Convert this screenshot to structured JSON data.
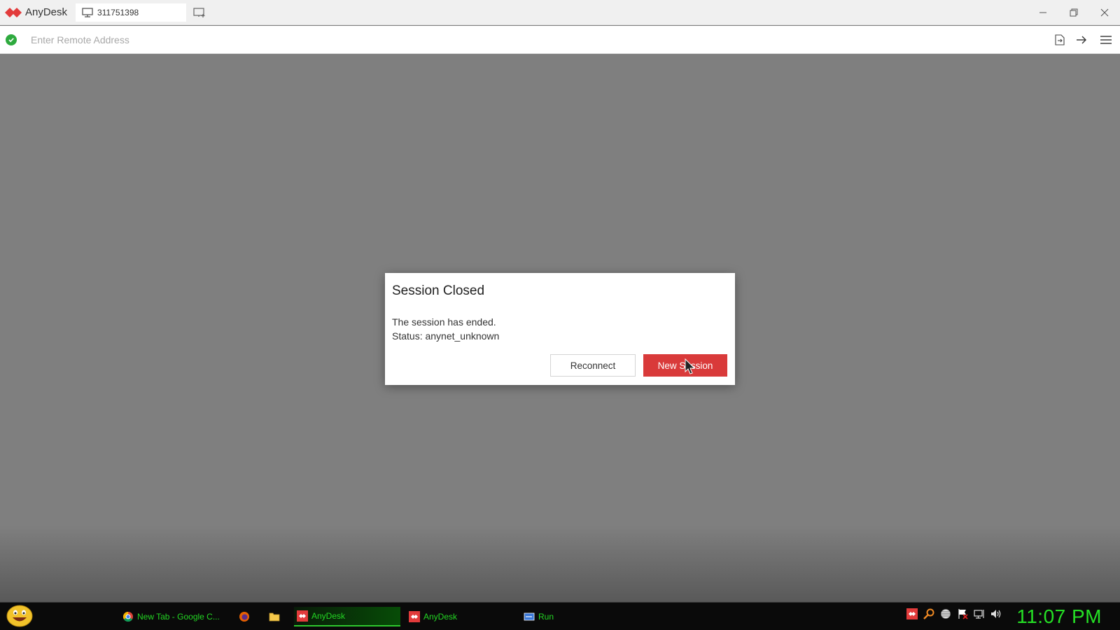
{
  "titlebar": {
    "app_name": "AnyDesk",
    "tab_label": "311751398",
    "brand_color": "#e23b3b"
  },
  "addressbar": {
    "placeholder": "Enter Remote Address",
    "status": "connected"
  },
  "dialog": {
    "title": "Session Closed",
    "message_line1": "The session has ended.",
    "message_line2": "Status: anynet_unknown",
    "reconnect_label": "Reconnect",
    "new_session_label": "New Session",
    "accent_color": "#d93a3a"
  },
  "taskbar": {
    "tasks": [
      {
        "label": "New Tab - Google C...",
        "icon": "chrome-icon"
      },
      {
        "label": "",
        "icon": "firefox-icon"
      },
      {
        "label": "",
        "icon": "folder-icon"
      },
      {
        "label": "AnyDesk",
        "icon": "anydesk-icon",
        "active": true
      },
      {
        "label": "AnyDesk",
        "icon": "anydesk-icon"
      },
      {
        "label": "Run",
        "icon": "run-icon"
      }
    ],
    "tray_icons": [
      "anydesk-tray-icon",
      "search-tray-icon",
      "network-globe-icon",
      "flag-icon",
      "display-icon",
      "volume-icon"
    ],
    "clock": "11:07 PM",
    "clock_color": "#25e025"
  }
}
